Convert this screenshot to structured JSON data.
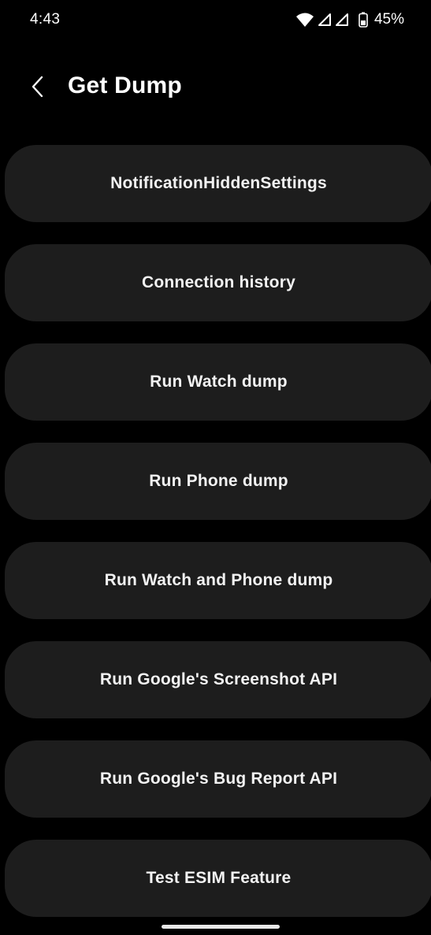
{
  "status_bar": {
    "time": "4:43",
    "battery_percent": "45%",
    "icons": [
      "wifi-icon",
      "signal-icon",
      "signal-icon",
      "battery-icon"
    ]
  },
  "header": {
    "title": "Get Dump",
    "back_icon": "chevron-left-icon"
  },
  "menu": {
    "items": [
      {
        "label": "NotificationHiddenSettings"
      },
      {
        "label": "Connection history"
      },
      {
        "label": "Run Watch dump"
      },
      {
        "label": "Run Phone dump"
      },
      {
        "label": "Run Watch and Phone dump"
      },
      {
        "label": "Run Google's Screenshot API"
      },
      {
        "label": "Run Google's Bug Report API"
      },
      {
        "label": "Test ESIM Feature"
      }
    ]
  },
  "colors": {
    "background": "#000000",
    "button_bg": "#1d1d1d",
    "text": "#ffffff"
  }
}
